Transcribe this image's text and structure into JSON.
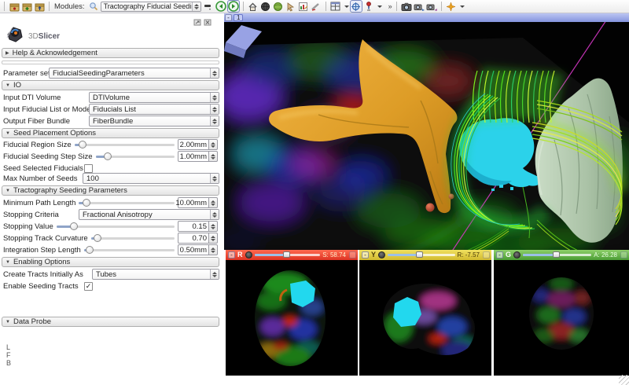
{
  "toolbar": {
    "modules_label": "Modules:",
    "module_selected": "Tractography Fiducial Seeding",
    "overflow_glyph": "»",
    "icons": [
      {
        "name": "load-scene-icon"
      },
      {
        "name": "add-data-icon"
      },
      {
        "name": "save-scene-icon"
      },
      {
        "name": "module-search-icon"
      },
      {
        "name": "module-history-icon"
      },
      {
        "name": "module-back-icon"
      },
      {
        "name": "module-forward-icon"
      },
      {
        "name": "home-module-icon"
      },
      {
        "name": "dark-globe-icon"
      },
      {
        "name": "green-globe-icon"
      },
      {
        "name": "pointer-icon"
      },
      {
        "name": "edit-chart-icon"
      },
      {
        "name": "annotation-ruler-icon"
      },
      {
        "name": "layout-grid-icon"
      },
      {
        "name": "crosshair-icon"
      },
      {
        "name": "fiducial-pin-icon"
      },
      {
        "name": "screenshot-camera-icon"
      },
      {
        "name": "sceneview-save-icon"
      },
      {
        "name": "sceneview-restore-icon"
      },
      {
        "name": "sparkle-icon"
      }
    ]
  },
  "panel": {
    "logo_text_light": "3D",
    "logo_text_bold": "Slicer",
    "help_header": "Help & Acknowledgement",
    "parameter_set": {
      "label": "Parameter set",
      "value": "FiducialSeedingParameters"
    },
    "io": {
      "header": "IO",
      "rows": [
        {
          "label": "Input DTI Volume",
          "value": "DTIVolume"
        },
        {
          "label": "Input Fiducial List or Model",
          "value": "Fiducials List"
        },
        {
          "label": "Output Fiber Bundle",
          "value": "FiberBundle"
        }
      ]
    },
    "seed_placement": {
      "header": "Seed Placement Options",
      "fiducial_region_size": {
        "label": "Fiducial Region Size",
        "value": "2.00mm"
      },
      "fiducial_seeding_step_size": {
        "label": "Fiducial Seeding Step Size",
        "value": "1.00mm"
      },
      "seed_selected_fiducials": {
        "label": "Seed Selected Fiducials",
        "checked": false
      },
      "max_number_of_seeds": {
        "label": "Max Number of Seeds",
        "value": "100"
      }
    },
    "tractography": {
      "header": "Tractography Seeding Parameters",
      "minimum_path_length": {
        "label": "Minimum Path Length",
        "value": "10.00mm"
      },
      "stopping_criteria": {
        "label": "Stopping Criteria",
        "value": "Fractional Anisotropy"
      },
      "stopping_value": {
        "label": "Stopping Value",
        "value": "0.15"
      },
      "stopping_track_curvature": {
        "label": "Stopping Track Curvature",
        "value": "0.70"
      },
      "integration_step_length": {
        "label": "Integration Step Length",
        "value": "0.50mm"
      }
    },
    "enabling": {
      "header": "Enabling Options",
      "create_tracts_initially_as": {
        "label": "Create Tracts Initially As",
        "value": "Tubes"
      },
      "enable_seeding_tracts": {
        "label": "Enable Seeding Tracts",
        "checked": true,
        "checkmark": "✓"
      }
    },
    "data_probe_header": "Data Probe",
    "orientation_labels": [
      "L",
      "F",
      "B"
    ]
  },
  "views": {
    "threed": {
      "collapse_glyph": "-",
      "id_label": "1"
    },
    "slices": [
      {
        "letter": "R",
        "offset": "S: 58.74",
        "color_top": "#ff6a50",
        "color_bottom": "#dd3322",
        "letter_color": "#ffffff",
        "value_color": "#ffeecc"
      },
      {
        "letter": "Y",
        "offset": "R: -7.57",
        "color_top": "#f0e060",
        "color_bottom": "#d2ba2e",
        "letter_color": "#4a3a08",
        "value_color": "#4a3a08"
      },
      {
        "letter": "G",
        "offset": "A: 26.28",
        "color_top": "#8ed06a",
        "color_bottom": "#4a9c34",
        "letter_color": "#ffffff",
        "value_color": "#e8ffe0"
      }
    ]
  }
}
